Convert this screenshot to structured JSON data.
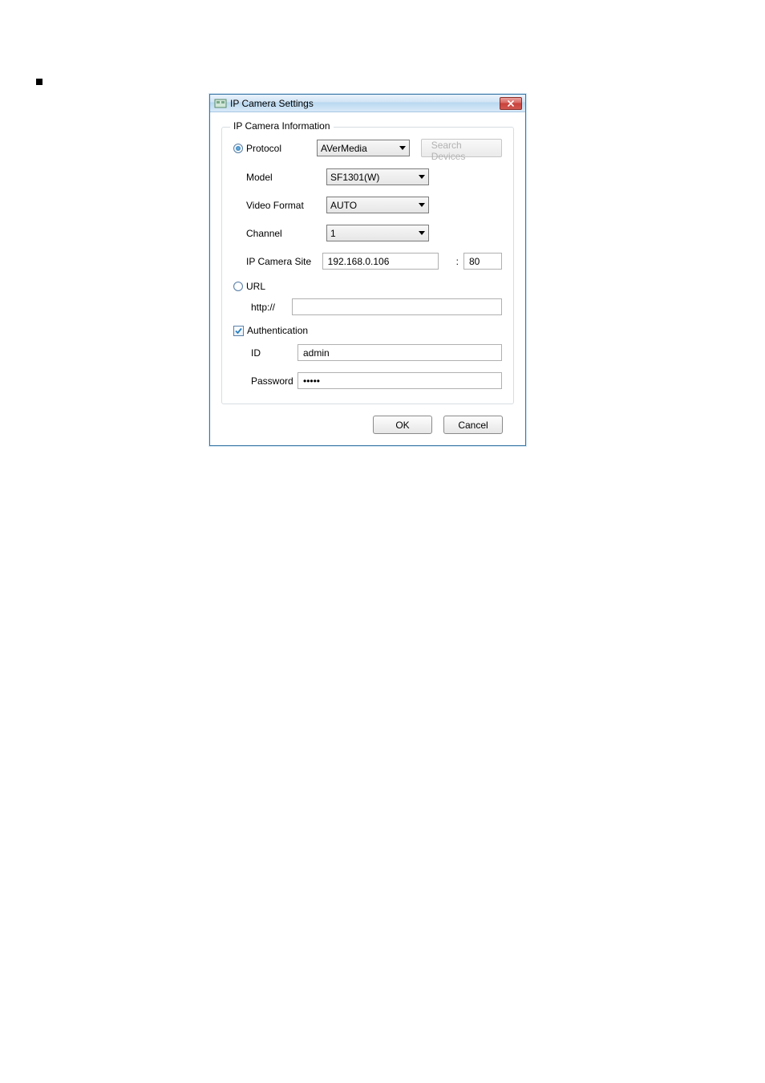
{
  "dialog": {
    "title": "IP Camera Settings",
    "fieldset_title": "IP Camera Information",
    "close_icon": "close"
  },
  "form": {
    "protocol": {
      "label": "Protocol",
      "value": "AVerMedia"
    },
    "model": {
      "label": "Model",
      "value": "SF1301(W)"
    },
    "video_format": {
      "label": "Video Format",
      "value": "AUTO"
    },
    "channel": {
      "label": "Channel",
      "value": "1"
    },
    "ip_camera_site": {
      "label": "IP Camera Site",
      "ip": "192.168.0.106",
      "port": "80",
      "colon": ":"
    },
    "url": {
      "label": "URL",
      "http": "http://",
      "value": ""
    },
    "authentication": {
      "label": "Authentication"
    },
    "id": {
      "label": "ID",
      "value": "admin"
    },
    "password": {
      "label": "Password",
      "value": "•••••"
    }
  },
  "buttons": {
    "search_devices": "Search Devices",
    "ok": "OK",
    "cancel": "Cancel"
  }
}
